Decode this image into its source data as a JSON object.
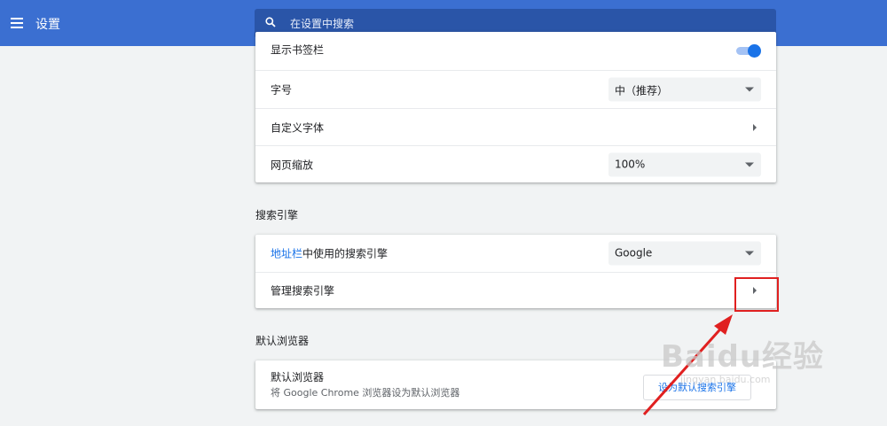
{
  "header": {
    "title": "设置",
    "search_placeholder": "在设置中搜索"
  },
  "appearance": {
    "rows": [
      {
        "label": "显示书签栏",
        "toggle_on": true
      },
      {
        "label": "字号",
        "value": "中（推荐）"
      },
      {
        "label": "自定义字体"
      },
      {
        "label": "网页缩放",
        "value": "100%"
      }
    ]
  },
  "search_engine": {
    "section_title": "搜索引擎",
    "address_bar": {
      "link": "地址栏",
      "label_rest": "中使用的搜索引擎",
      "value": "Google"
    },
    "manage_label": "管理搜索引擎"
  },
  "default_browser": {
    "section_title": "默认浏览器",
    "label": "默认浏览器",
    "sublabel": "将 Google Chrome 浏览器设为默认浏览器",
    "button_label": "设为默认搜索引擎"
  },
  "colors": {
    "header": "#3b6fd1",
    "search_bg": "#2a55a8",
    "accent": "#1a73e8",
    "highlight": "#e02020"
  },
  "watermark": {
    "brand": "Baidu经验",
    "url": "jingyan.baidu.com"
  }
}
